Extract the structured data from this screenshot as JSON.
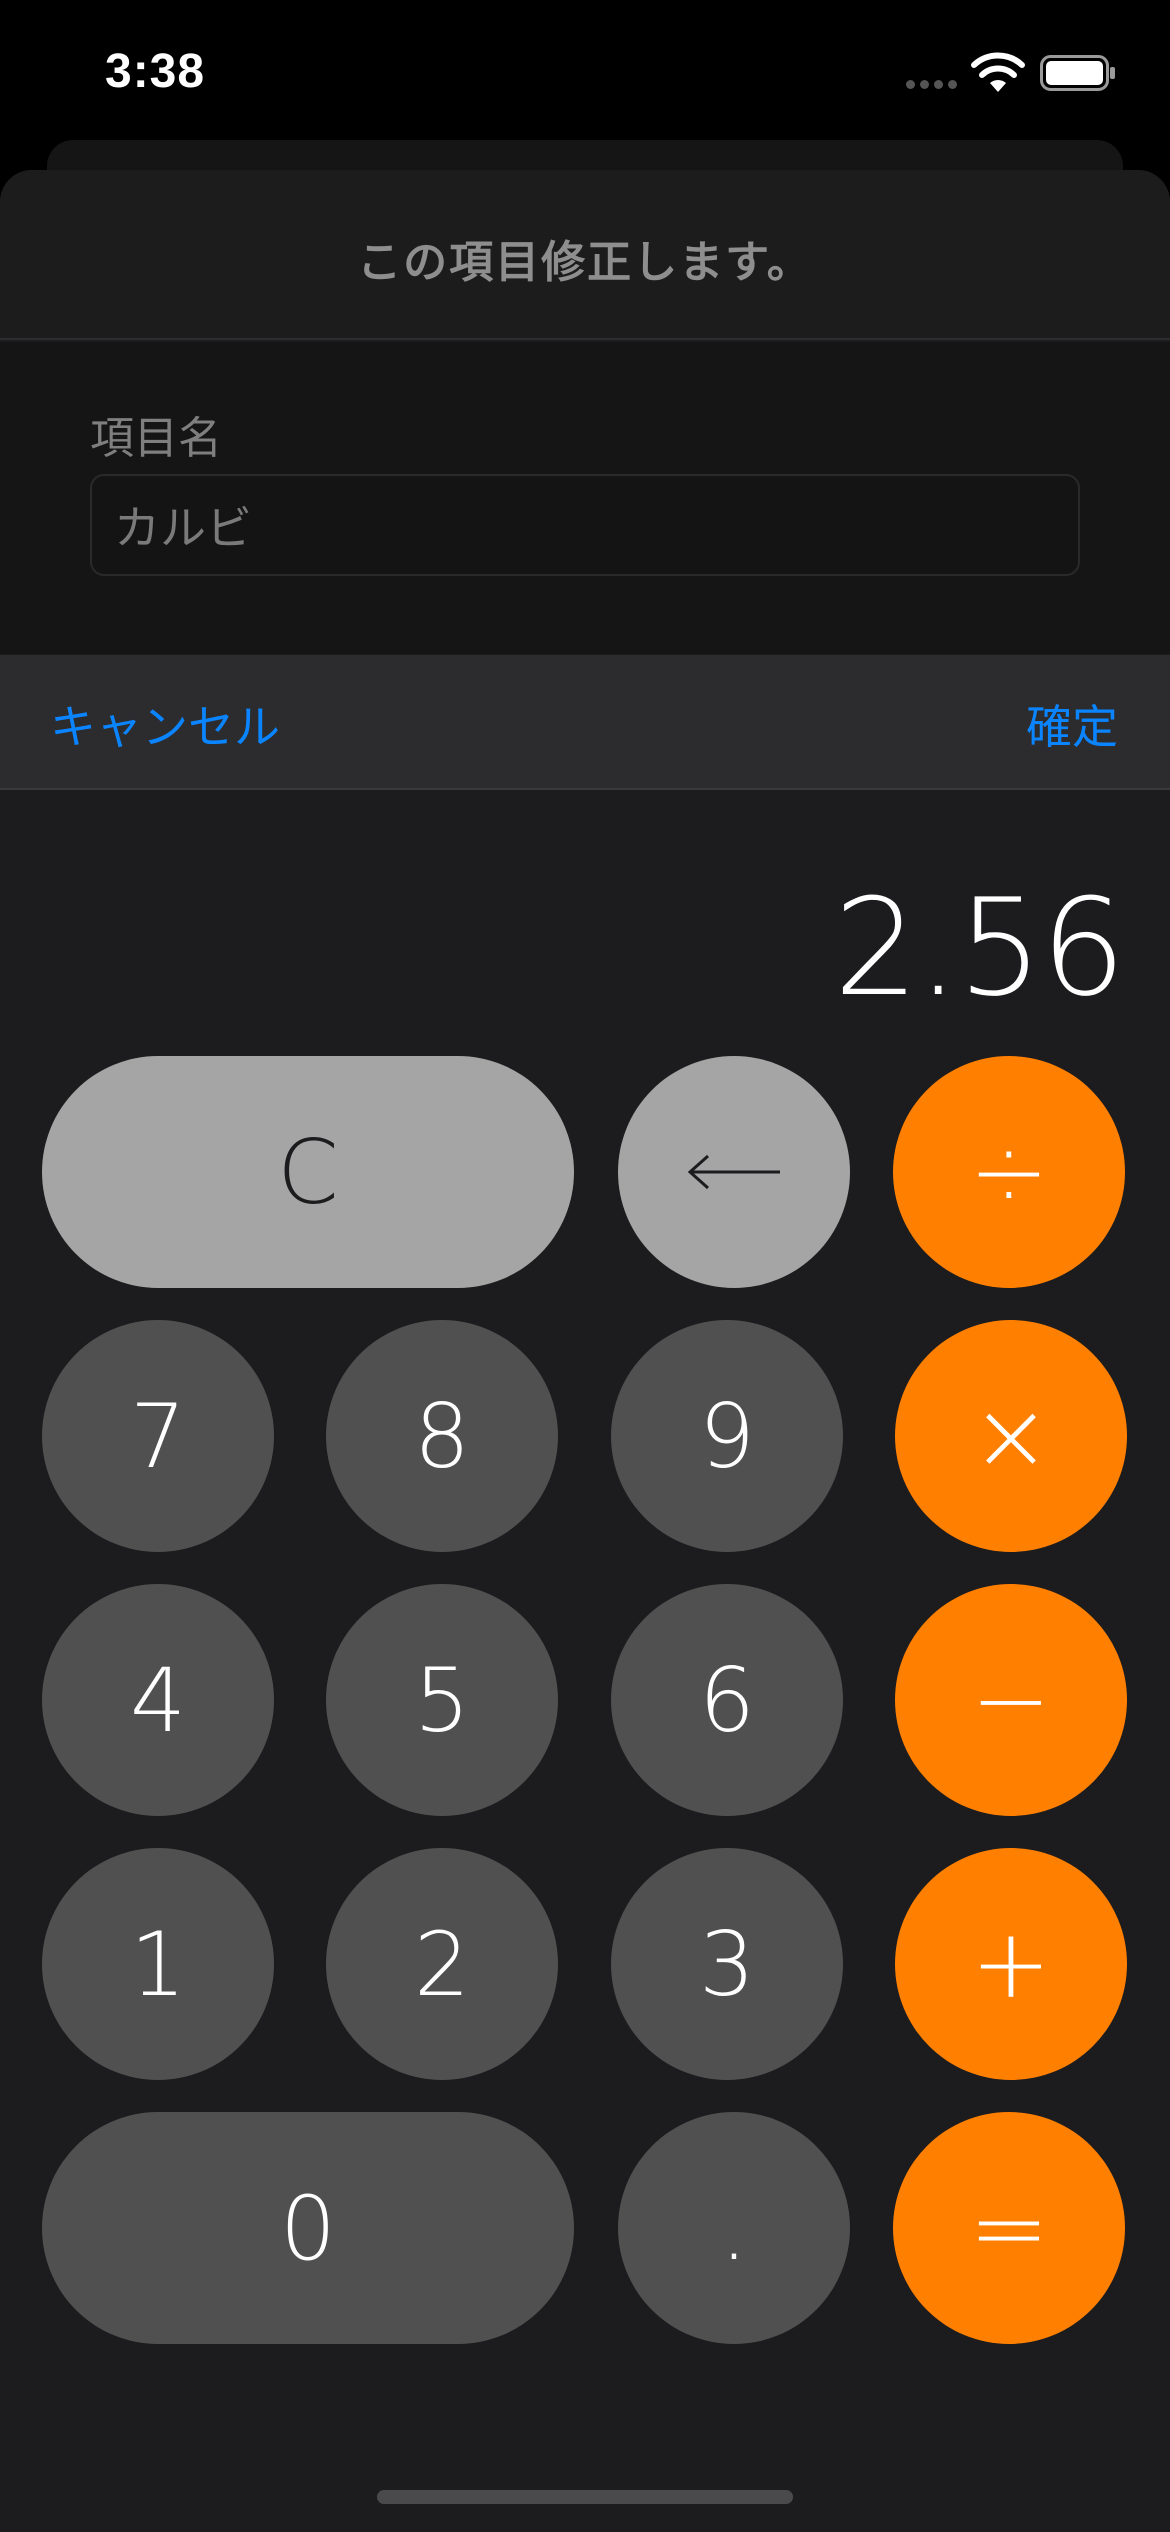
{
  "status_bar": {
    "time": "3:38",
    "icons": [
      "signal-icon",
      "wifi-icon",
      "battery-icon"
    ]
  },
  "sheet": {
    "title": "この項目修正します。",
    "field_label": "項目名",
    "field_value": "カルビ"
  },
  "actions": {
    "cancel_label": "キャンセル",
    "confirm_label": "確定",
    "accent_color": "#0a84ff"
  },
  "calculator": {
    "display": "2.56",
    "keys": {
      "clear": "C",
      "backspace": "⟵",
      "divide": "÷",
      "multiply": "×",
      "subtract": "−",
      "add": "+",
      "equals": "=",
      "seven": "7",
      "eight": "8",
      "nine": "9",
      "four": "4",
      "five": "5",
      "six": "6",
      "one": "1",
      "two": "2",
      "three": "3",
      "zero": "0",
      "decimal": "."
    },
    "colors": {
      "function_key": "#a5a5a5",
      "number_key": "#505050",
      "operator_key": "#ff7f00"
    }
  }
}
